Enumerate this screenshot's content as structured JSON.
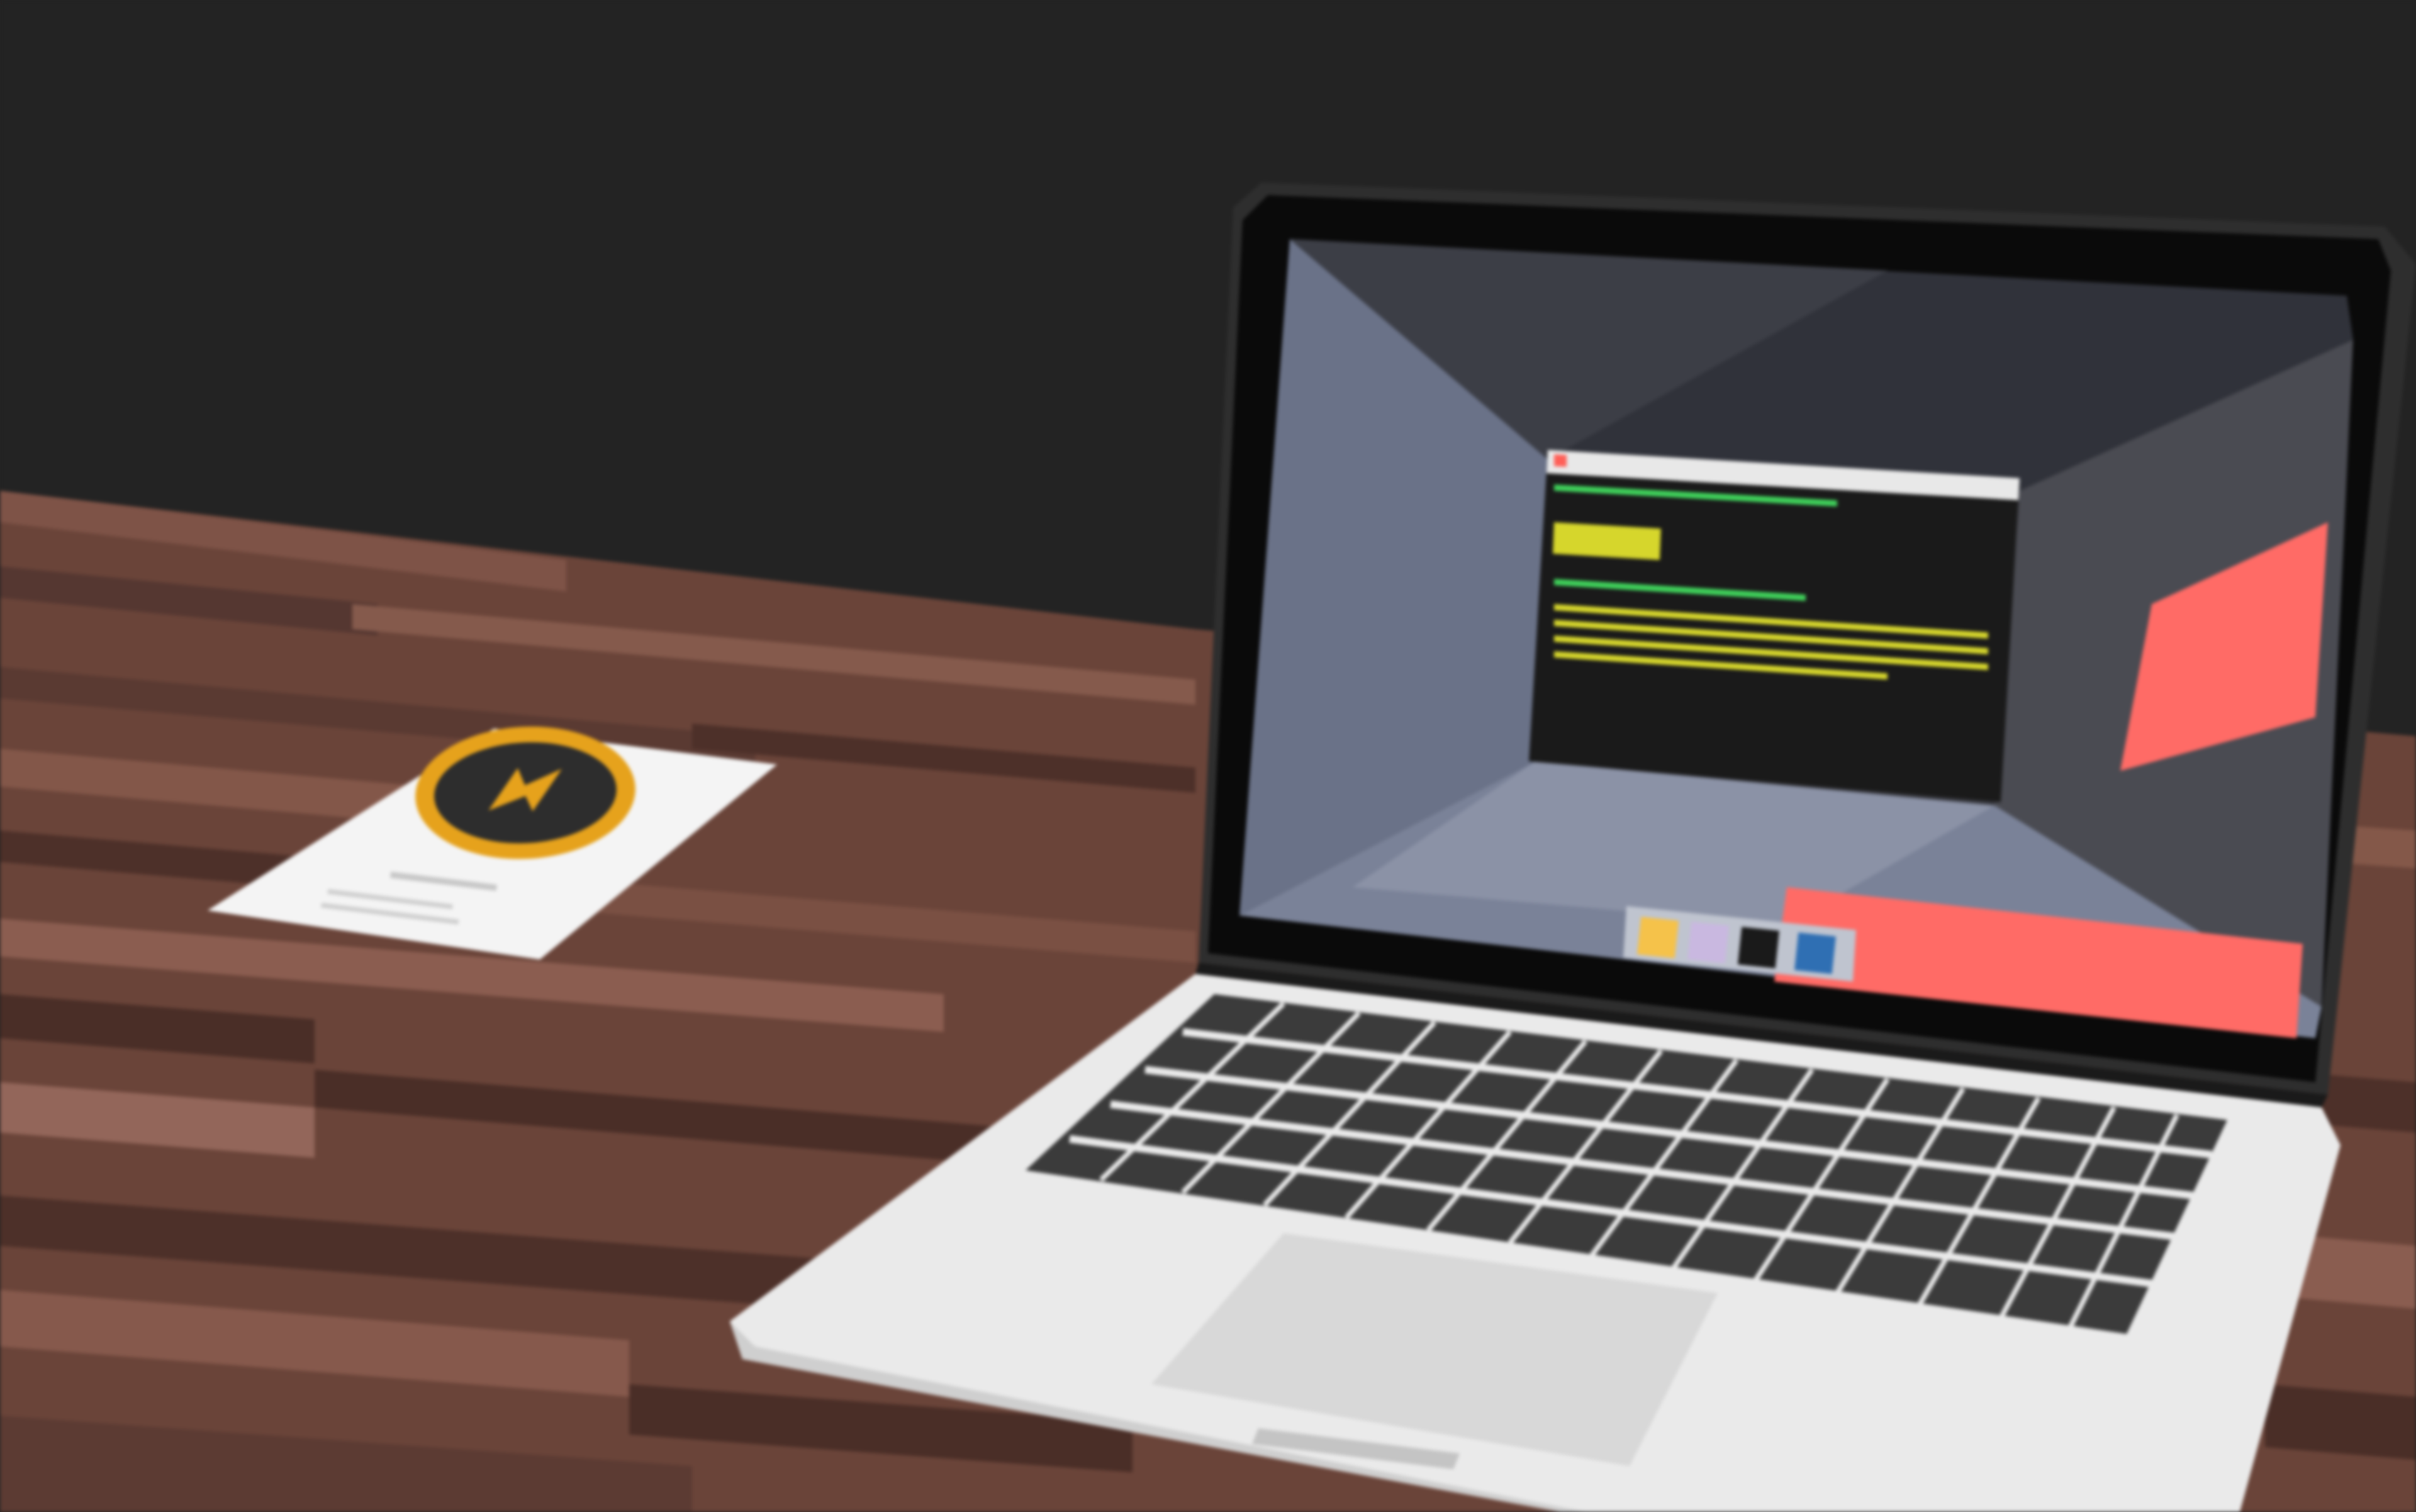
{
  "scene": {
    "colors": {
      "wall": "#232323",
      "desk_light": "#7e5347",
      "desk_mid": "#6a4439",
      "desk_dark": "#4d3029",
      "card": "#f4f4f4",
      "badge_ring": "#e6a21c",
      "badge_core": "#2d2d2d",
      "laptop_body": "#eaeaea",
      "laptop_bezel": "#0a0a0a",
      "screen_left": "#6a7288",
      "screen_top": "#30323a",
      "screen_right": "#4a4b52",
      "screen_floor": "#7a8298",
      "accent_red": "#ff6b66",
      "terminal_bg": "#1a1a1a",
      "terminal_green": "#3fd05a",
      "terminal_yellow": "#d6d62c",
      "keys": "#3b3b3b",
      "trackpad": "#d8d8d8"
    },
    "icons": {
      "laptop": "laptop-icon",
      "terminal": "terminal-window-icon",
      "dock": "dock-icon",
      "business_card": "business-card-icon",
      "badge": "lightning-badge-icon"
    }
  }
}
